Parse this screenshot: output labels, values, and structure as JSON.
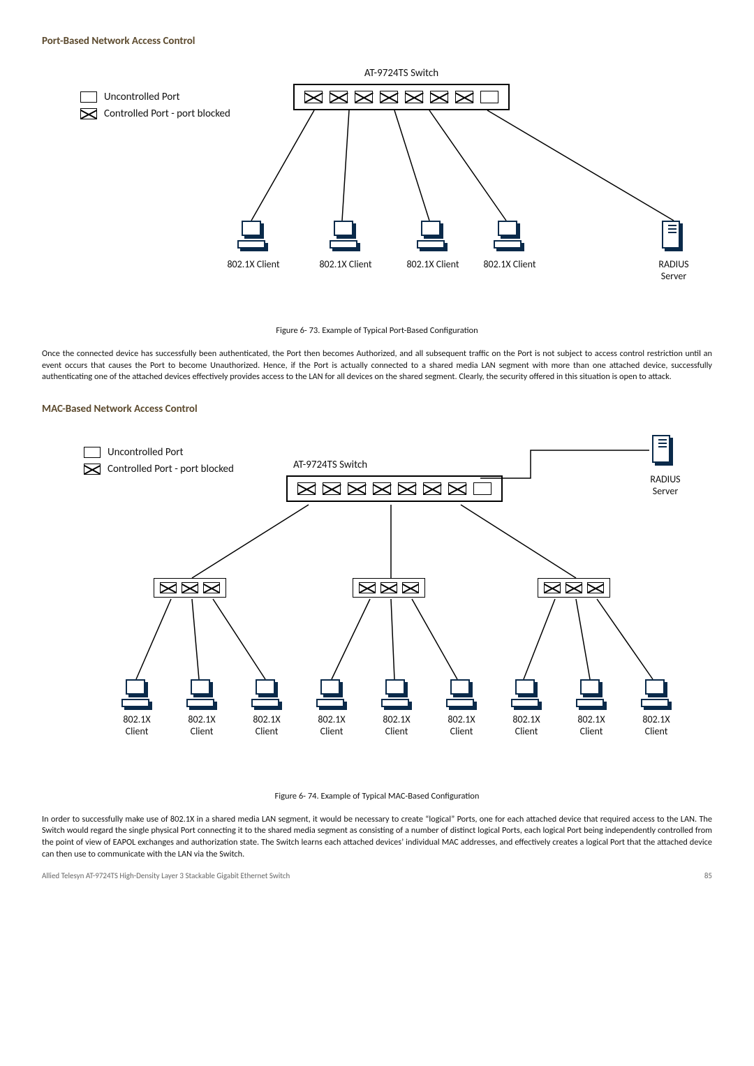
{
  "section_port": "Port-Based Network Access Control",
  "section_mac": "MAC-Based Network Access Control",
  "legend": {
    "uncontrolled": "Uncontrolled Port",
    "controlled_blocked": "Controlled Port - port blocked"
  },
  "switch_label": "AT-9724TS Switch",
  "client_label": "802.1X Client",
  "client_label_2line_a": "802.1X",
  "client_label_2line_b": "Client",
  "radius_label_a": "RADIUS",
  "radius_label_b": "Server",
  "fig73_caption": "Figure 6- 73. Example of Typical Port-Based Configuration",
  "fig73_para": "Once the connected device has successfully been authenticated, the Port then becomes Authorized, and all subsequent traffic on the Port is not subject to access control restriction until an event occurs that causes the Port to become Unauthorized. Hence, if the Port is actually connected to a shared media LAN segment with more than one attached device, successfully authenticating one of the attached devices effectively provides access to the LAN for all devices on the shared segment. Clearly, the security offered in this situation is open to attack.",
  "fig74_caption": "Figure 6- 74. Example of Typical MAC-Based Configuration",
  "fig74_para": "In order to successfully make use of 802.1X in a shared media LAN segment, it would be necessary to create “logical” Ports, one for each attached device that required access to the LAN. The Switch would regard the single physical Port connecting it to the shared media segment as consisting of a number of distinct logical Ports, each logical Port being independently controlled from the point of view of EAPOL exchanges and authorization state. The Switch learns each attached devices’ individual MAC addresses, and effectively creates a logical Port that the attached device can then use to communicate with the LAN via the Switch.",
  "footer_left": "Allied Telesyn AT-9724TS High-Density Layer 3 Stackable Gigabit Ethernet Switch",
  "footer_right": "85"
}
